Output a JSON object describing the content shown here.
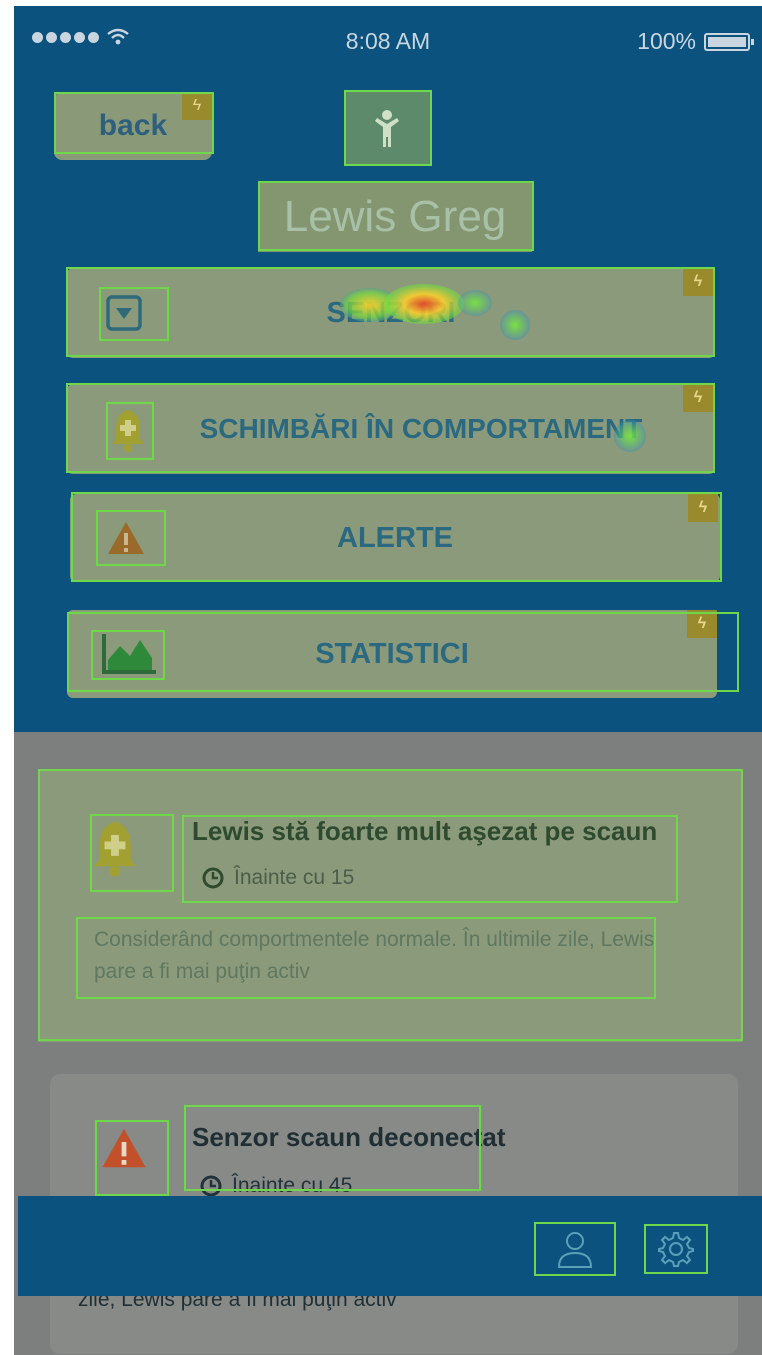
{
  "status_bar": {
    "time": "8:08 AM",
    "battery": "100%"
  },
  "header": {
    "back_label": "back",
    "patient_name": "Lewis Greg"
  },
  "menu": {
    "items": [
      {
        "label": "SENZORI",
        "icon": "dropdown-square-icon"
      },
      {
        "label": "SCHIMBĂRI ÎN COMPORTAMENT",
        "icon": "bell-plus-icon"
      },
      {
        "label": "ALERTE",
        "icon": "warning-triangle-icon"
      },
      {
        "label": "STATISTICI",
        "icon": "area-chart-icon"
      }
    ]
  },
  "notifications": [
    {
      "title": "Lewis stă foarte mult aşezat pe scaun",
      "time": "Înainte cu 15",
      "description": "Considerând comportmentele normale. În ultimile zile, Lewis pare a fi mai puţin activ",
      "icon": "bell-plus-icon"
    },
    {
      "title": "Senzor scaun deconectat",
      "time": "Înainte cu 45",
      "description": "zile, Lewis pare a fi mai puţin activ",
      "icon": "warning-triangle-icon"
    }
  ],
  "tab_bar": {
    "icons": [
      "user-icon",
      "gear-icon"
    ]
  },
  "colors": {
    "header_bg": "#0b527e",
    "overlay": "#8b9a7a",
    "highlight": "#6fd84a",
    "warning": "#c2502a",
    "bell": "#a2a030"
  }
}
